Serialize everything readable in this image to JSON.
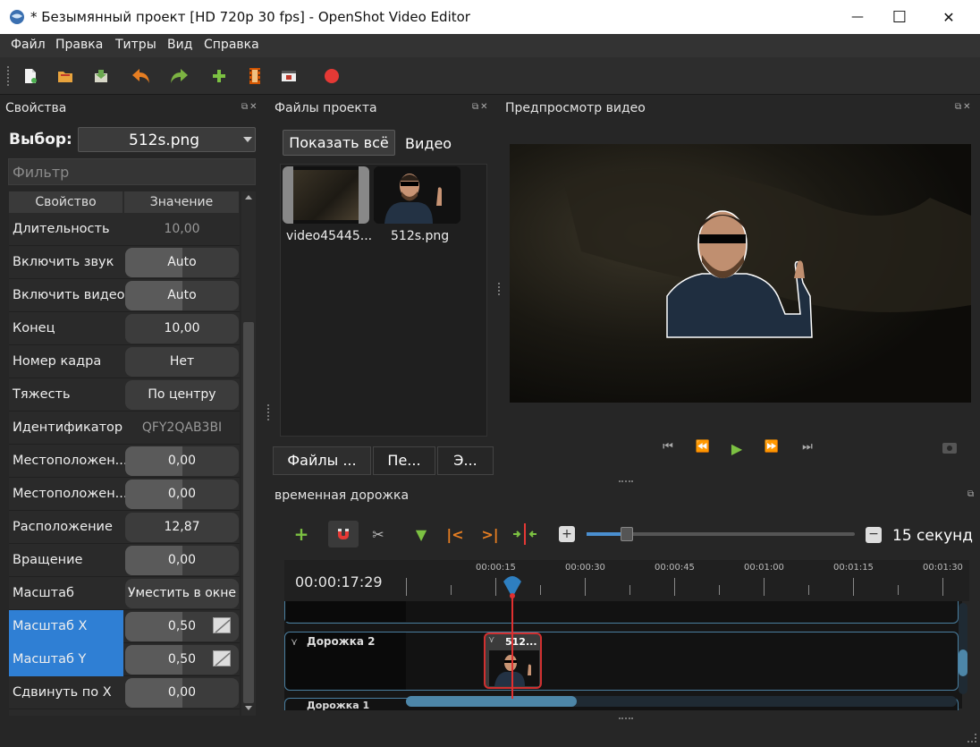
{
  "window": {
    "title": "* Безымянный проект [HD 720p 30 fps] - OpenShot Video Editor",
    "minimize": "—",
    "maximize": "☐",
    "close": "✕"
  },
  "menu": [
    "Файл",
    "Правка",
    "Титры",
    "Вид",
    "Справка"
  ],
  "toolbar": {
    "icons": [
      "new-project-icon",
      "open-project-icon",
      "save-project-icon",
      "undo-icon",
      "redo-icon",
      "import-files-icon",
      "profile-icon",
      "export-icon",
      "record-icon"
    ]
  },
  "properties": {
    "title": "Свойства",
    "select_label": "Выбор:",
    "select_value": "512s.png",
    "filter_placeholder": "Фильтр",
    "col_property": "Свойство",
    "col_value": "Значение",
    "rows": [
      {
        "name": "Длительность",
        "value": "10,00",
        "fill": 0
      },
      {
        "name": "Включить звук",
        "value": "Auto",
        "fill": 0.5
      },
      {
        "name": "Включить видео",
        "value": "Auto",
        "fill": 0.5
      },
      {
        "name": "Конец",
        "value": "10,00",
        "fill": 0
      },
      {
        "name": "Номер кадра",
        "value": "Нет",
        "fill": 0
      },
      {
        "name": "Тяжесть",
        "value": "По центру",
        "fill": 0
      },
      {
        "name": "Идентификатор",
        "value": "QFY2QAB3BI",
        "fill": 0
      },
      {
        "name": "Местоположен...",
        "value": "0,00",
        "fill": 0.5
      },
      {
        "name": "Местоположен...",
        "value": "0,00",
        "fill": 0.5
      },
      {
        "name": "Расположение",
        "value": "12,87",
        "fill": 0
      },
      {
        "name": "Вращение",
        "value": "0,00",
        "fill": 0.5
      },
      {
        "name": "Масштаб",
        "value": "Уместить в окне",
        "fill": 0
      },
      {
        "name": "Масштаб X",
        "value": "0,50",
        "fill": 0.5
      },
      {
        "name": "Масштаб Y",
        "value": "0,50",
        "fill": 0.5
      },
      {
        "name": "Сдвинуть по X",
        "value": "0,00",
        "fill": 0.5
      }
    ]
  },
  "files": {
    "title": "Файлы проекта",
    "show_all": "Показать всё",
    "video_filter": "Видео",
    "items": [
      "video45445...",
      "512s.png"
    ],
    "tabs": [
      "Файлы ...",
      "Пе...",
      "Э..."
    ]
  },
  "preview": {
    "title": "Предпросмотр видео"
  },
  "timeline": {
    "title": "временная дорожка",
    "zoom_label": "15 секунд",
    "timecode": "00:00:17:29",
    "ruler": [
      "00:00:15",
      "00:00:30",
      "00:00:45",
      "00:01:00",
      "00:01:15",
      "00:01:30"
    ],
    "tracks": [
      "Дорожка 2",
      "Дорожка 1"
    ],
    "clip_label": "512..."
  },
  "colors": {
    "accent": "#2f7fd4",
    "playhead": "#e03030",
    "track_border": "#4a7fa0"
  }
}
